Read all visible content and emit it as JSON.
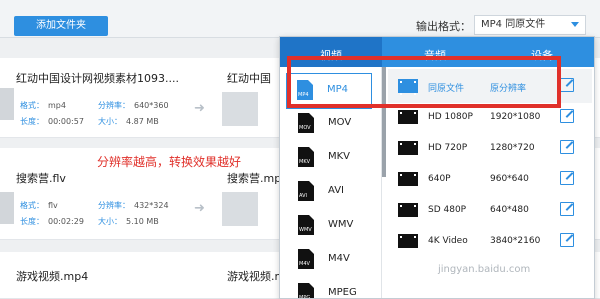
{
  "toolbar": {
    "add_button": "添加文件夹",
    "format_label": "输出格式：",
    "format_value": "MP4 同原文件"
  },
  "files": [
    {
      "name": "红动中国设计网视频素材1093....",
      "target_name": "红动中国",
      "format_label": "格式：",
      "format": "mp4",
      "res_label": "分辨率：",
      "resolution": "640*360",
      "dur_label": "长度：",
      "duration": "00:00:57",
      "size_label": "大小：",
      "size": "4.87 MB"
    },
    {
      "name": "搜索营.flv",
      "target_name": "搜索营.mp",
      "format_label": "格式：",
      "format": "flv",
      "res_label": "分辨率：",
      "resolution": "432*324",
      "dur_label": "长度：",
      "duration": "00:02:29",
      "size_label": "大小：",
      "size": "5.10 MB"
    },
    {
      "name": "游戏视频.mp4",
      "target_name": "游戏视频.mp"
    }
  ],
  "annotation": "分辨率越高，转换效果越好",
  "panel": {
    "tabs": [
      "视频",
      "音频",
      "设备"
    ],
    "formats": [
      "MP4",
      "MOV",
      "MKV",
      "AVI",
      "WMV",
      "M4V",
      "MPEG"
    ],
    "selected_format": "MP4",
    "presets": [
      {
        "name": "同原文件",
        "resolution": "原分辨率"
      },
      {
        "name": "HD 1080P",
        "resolution": "1920*1080"
      },
      {
        "name": "HD 720P",
        "resolution": "1280*720"
      },
      {
        "name": "640P",
        "resolution": "960*640"
      },
      {
        "name": "SD 480P",
        "resolution": "640*480"
      },
      {
        "name": "4K Video",
        "resolution": "3840*2160"
      }
    ]
  },
  "watermark": "jingyan.baidu.com",
  "colors": {
    "accent": "#2e8fe0",
    "highlight_box": "#e0302a"
  }
}
